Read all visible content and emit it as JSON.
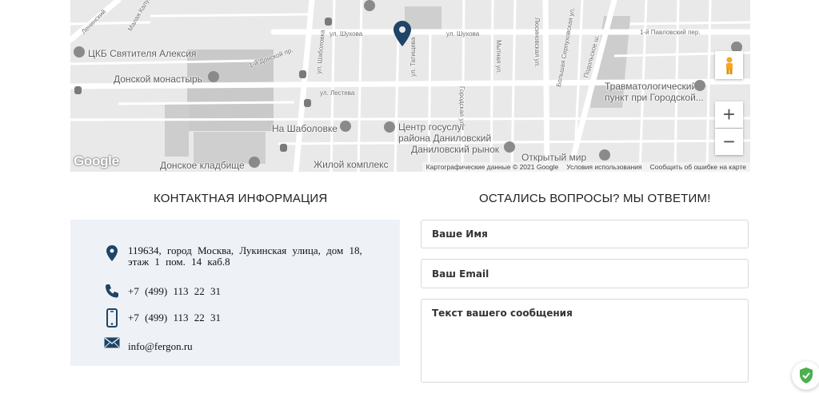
{
  "map": {
    "labels": {
      "leninsky": "Ленинский",
      "malaya_kaluzhskaya": "Малая Калужская ул.",
      "ckb": "ЦКБ Святителя Алексия",
      "donskoy_monastery": "Донской монастырь",
      "donskoy_cemetery": "Донское кладбище",
      "na_shabolovke": "На Шаболовке",
      "zhiloy_kompleks": "Жилой комплекс",
      "gosuslugi_line1": "Центр госуслуг",
      "gosuslugi_line2": "района Даниловский",
      "danilovsky_market": "Даниловский рынок",
      "otkryty_mir": "Открытый мир",
      "trauma_line1": "Травматологический",
      "trauma_line2": "пункт при Городской...",
      "shukhova_1": "ул. Шухова",
      "shukhova_2": "ул. Шухова",
      "shabolovka": "ул. Шаболовка",
      "lesteva": "ул. Лестева",
      "tatishcheva": "ул. Татищева",
      "gorodskaya": "Городская ул.",
      "mytnaya": "Мытная ул.",
      "lusinovskaya": "Люсиновская ул.",
      "bolshaya_serpukhovskaya": "Большая Серпуховская ул.",
      "podolskoe": "Подольское ш.",
      "pavlovsky": "1-й Павловский пер.",
      "donskoy_proezd": "1-й Донской пр."
    },
    "zoom_in": "+",
    "zoom_out": "−",
    "google_logo": "Google",
    "attribution": {
      "data": "Картографические данные © 2021 Google",
      "terms": "Условия использования",
      "report": "Сообщить об ошибке на карте"
    }
  },
  "contact": {
    "title": "КОНТАКТНАЯ ИНФОРМАЦИЯ",
    "address_line1": "119634, город Москва, Лукинская улица, дом 18,",
    "address_line2": "этаж 1 пом. 14 каб.8",
    "phone": "+7 (499) 113 22 31",
    "mobile": "+7 (499) 113 22 31",
    "email": "info@fergon.ru",
    "icon_color": "#1e4466"
  },
  "form": {
    "title": "ОСТАЛИСЬ ВОПРОСЫ? МЫ ОТВЕТИМ!",
    "name_placeholder": "Ваше Имя",
    "email_placeholder": "Ваш Email",
    "message_placeholder": "Текст вашего сообщения"
  },
  "icons": {
    "marker": "map-marker-icon",
    "pegman": "pegman-icon",
    "location": "location-pin-icon",
    "phone": "phone-icon",
    "mobile": "mobile-phone-icon",
    "email": "envelope-icon",
    "badge": "shield-check-icon"
  }
}
